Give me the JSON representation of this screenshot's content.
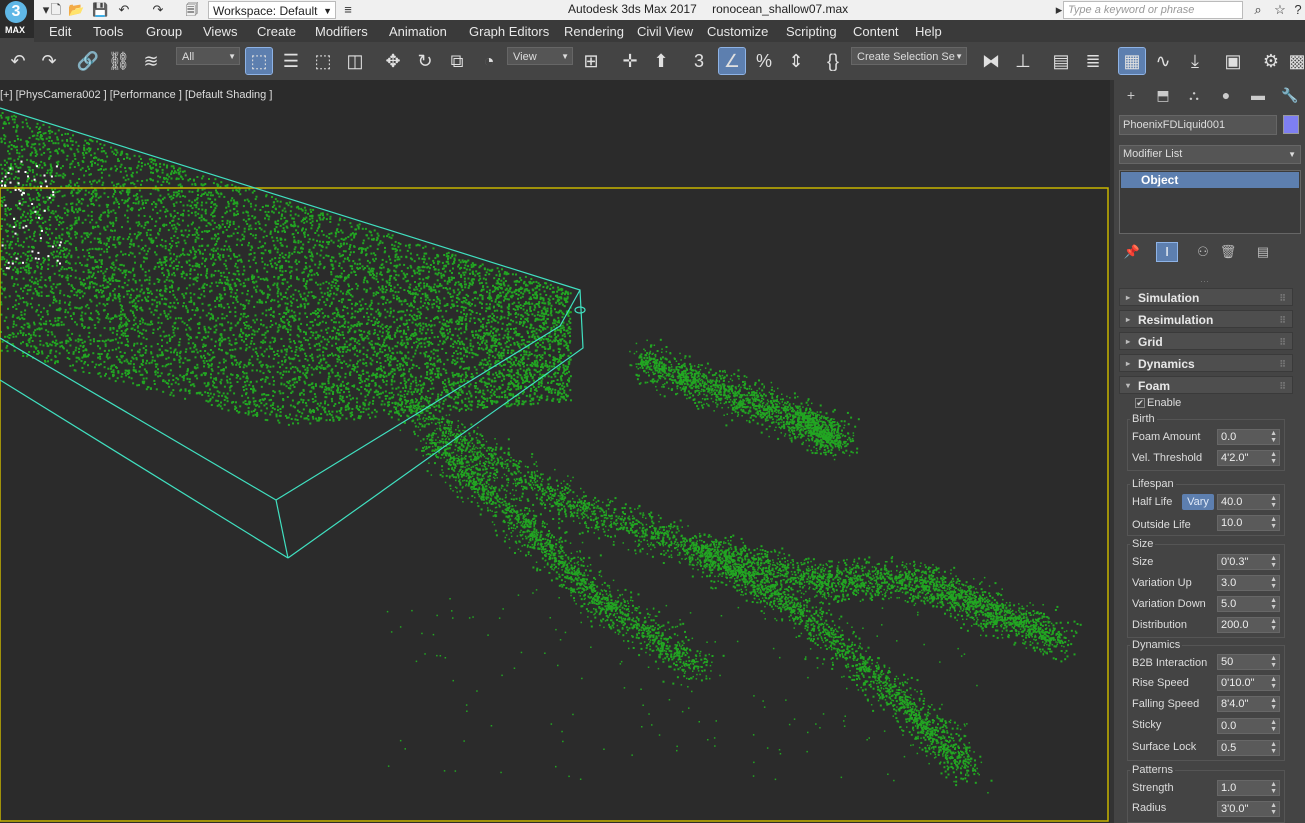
{
  "titlebar": {
    "workspace": "Workspace: Default",
    "app_title": "Autodesk 3ds Max 2017",
    "file_name": "ronocean_shallow07.max",
    "search_placeholder": "Type a keyword or phrase"
  },
  "logo": {
    "number": "3",
    "text": "MAX"
  },
  "menu": [
    "Edit",
    "Tools",
    "Group",
    "Views",
    "Create",
    "Modifiers",
    "Animation",
    "Graph Editors",
    "Rendering",
    "Civil View",
    "Customize",
    "Scripting",
    "Content",
    "Help"
  ],
  "toolbar": {
    "selection_filter": "All",
    "ref_coord": "View",
    "named_selection": "Create Selection Se"
  },
  "viewport": {
    "label": "[+] [PhysCamera002 ] [Performance ] [Default Shading ]",
    "particle_color": "#22a622",
    "bbox_color": "#40e0c0",
    "frame_color": "#c8b400"
  },
  "command_panel": {
    "object_name": "PhoenixFDLiquid001",
    "object_color": "#7e7ff2",
    "modifier_list": "Modifier List",
    "stack_item": "Object",
    "rollouts": [
      "Simulation",
      "Resimulation",
      "Grid",
      "Dynamics",
      "Foam"
    ],
    "foam": {
      "enable_label": "Enable",
      "enabled": true,
      "birth": {
        "title": "Birth",
        "params": [
          {
            "label": "Foam Amount",
            "value": "0.0"
          },
          {
            "label": "Vel. Threshold",
            "value": "4'2.0\""
          }
        ]
      },
      "lifespan": {
        "title": "Lifespan",
        "vary_label": "Vary",
        "params": [
          {
            "label": "Half Life",
            "value": "40.0"
          },
          {
            "label": "Outside Life",
            "value": "10.0"
          }
        ]
      },
      "size": {
        "title": "Size",
        "params": [
          {
            "label": "Size",
            "value": "0'0.3\""
          },
          {
            "label": "Variation Up",
            "value": "3.0"
          },
          {
            "label": "Variation Down",
            "value": "5.0"
          },
          {
            "label": "Distribution",
            "value": "200.0"
          }
        ]
      },
      "dynamics": {
        "title": "Dynamics",
        "params": [
          {
            "label": "B2B Interaction",
            "value": "50"
          },
          {
            "label": "Rise Speed",
            "value": "0'10.0\""
          },
          {
            "label": "Falling Speed",
            "value": "8'4.0\""
          },
          {
            "label": "Sticky",
            "value": "0.0"
          },
          {
            "label": "Surface Lock",
            "value": "0.5"
          }
        ]
      },
      "patterns": {
        "title": "Patterns",
        "params": [
          {
            "label": "Strength",
            "value": "1.0"
          },
          {
            "label": "Radius",
            "value": "3'0.0\""
          }
        ]
      }
    }
  }
}
